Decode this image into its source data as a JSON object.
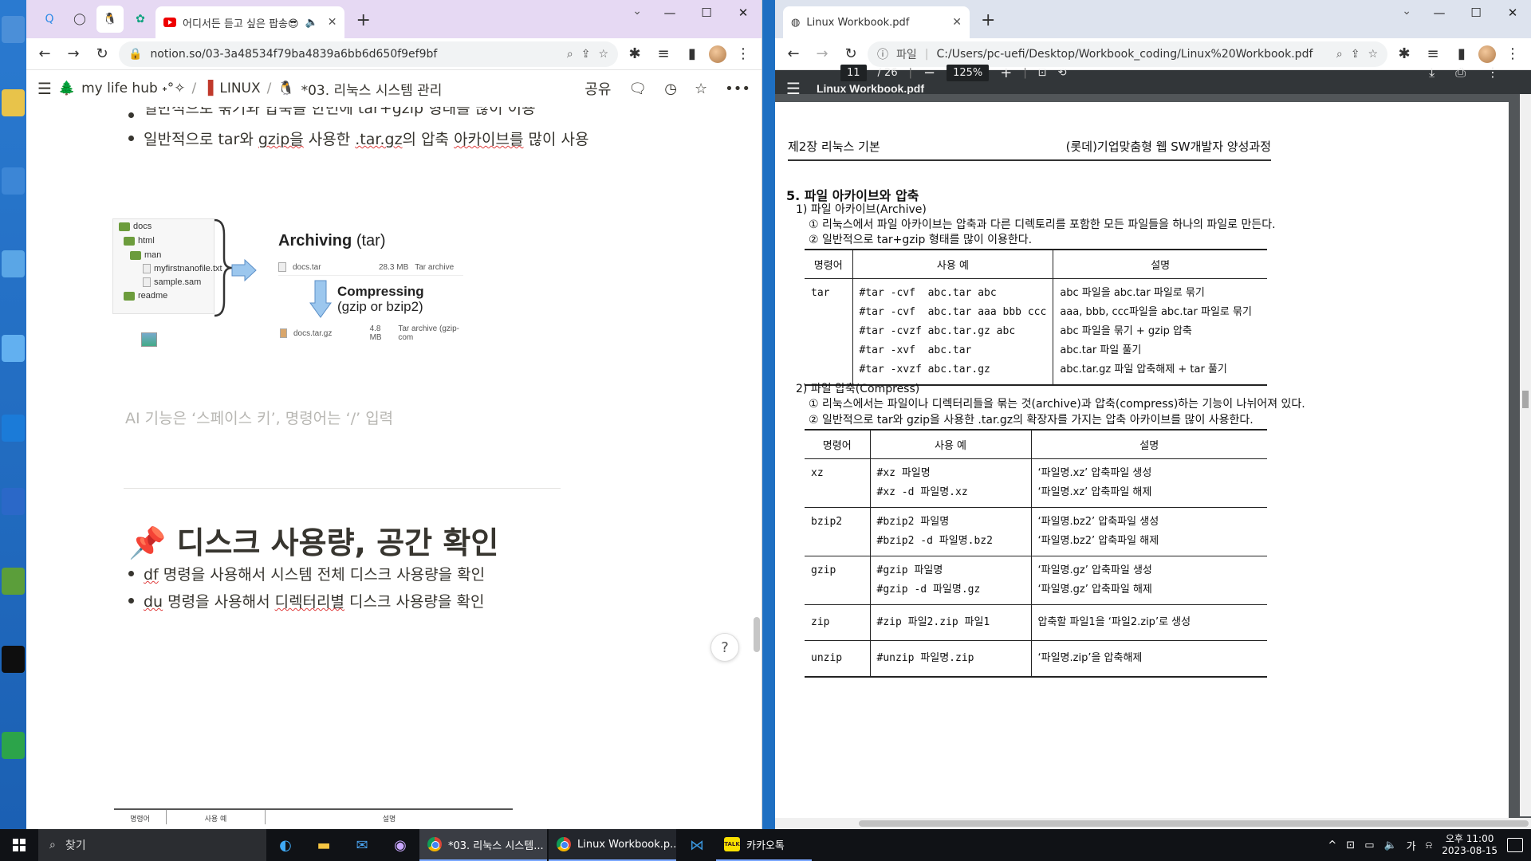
{
  "left_window": {
    "tabs": [
      {
        "icon": "qq-icon"
      },
      {
        "icon": "github-icon"
      },
      {
        "icon": "notion-penguin-icon",
        "active": true
      },
      {
        "icon": "chatgpt-icon"
      }
    ],
    "youtube_tab_title": "어디서든 듣고 싶은 팝송😎",
    "url": "notion.so/03-3a48534f79ba4839a6bb6d650f9ef9bf",
    "breadcrumb": {
      "workspace": "my life hub ˖°✧",
      "parent": "LINUX",
      "page": "*03. 리눅스 시스템 관리"
    },
    "share_label": "공유",
    "content": {
      "bullet_top_partial": "일반적으로 묶기와 압축을 한번에 tar+gzip 형태를 많이 이용",
      "bullet_2": {
        "pre": "일반적으로 tar와 ",
        "w1": "gzip을",
        "mid": " 사용한 ",
        "w2": ".tar.gz",
        "mid2": "의 압축 ",
        "w3": "아카이브를",
        "post": " 많이 사용"
      },
      "diagram": {
        "tree": [
          "docs",
          "html",
          "man",
          "myfirstnanofile.txt",
          "sample.sam",
          "readme"
        ],
        "archiving_label": "Archiving",
        "archiving_tool": "(tar)",
        "tar_file": "docs.tar",
        "tar_size": "28.3 MB",
        "tar_type": "Tar archive",
        "compressing_label": "Compressing",
        "compressing_tools": "(gzip or bzip2)",
        "gz_file": "docs.tar.gz",
        "gz_size": "4.8 MB",
        "gz_type": "Tar archive (gzip-com"
      },
      "ai_placeholder": "AI 기능은 ‘스페이스 키’, 명령어는 ‘/’ 입력",
      "heading_emoji": "📌",
      "heading": "디스크 사용량, 공간 확인",
      "bullet_df": {
        "cmd": "df",
        "text": " 명령을 사용해서 시스템 전체 디스크 사용량을 확인"
      },
      "bullet_du": {
        "cmd": "du",
        "text_a": " 명령을 사용해서 ",
        "word": "디렉터리별",
        "text_b": " 디스크 사용량을 확인"
      },
      "mini_table_headers": [
        "명령어",
        "사용 예",
        "설명"
      ],
      "help_label": "?"
    }
  },
  "right_window": {
    "tab_title": "Linux Workbook.pdf",
    "url_prefix": "파일",
    "url": "C:/Users/pc-uefi/Desktop/Workbook_coding/Linux%20Workbook.pdf",
    "pdf_title": "Linux Workbook.pdf",
    "page_current": "11",
    "page_total": "/ 26",
    "zoom": "125%",
    "page": {
      "header_left": "제2장 리눅스 기본",
      "header_right": "(롯데)기업맞춤형 웹 SW개발자 양성과정",
      "section": "5. 파일 아카이브와 압축",
      "sub1": "1) 파일 아카이브(Archive)",
      "sub1_items": [
        "① 리눅스에서 파일 아카이브는 압축과 다른 디렉토리를 포함한 모든 파일들을 하나의 파일로 만든다.",
        "② 일반적으로 tar+gzip 형태를 많이 이용한다."
      ],
      "table1": {
        "headers": [
          "명령어",
          "사용 예",
          "설명"
        ],
        "command": "tar",
        "examples": "#tar -cvf  abc.tar abc\n#tar -cvf  abc.tar aaa bbb ccc\n#tar -cvzf abc.tar.gz abc\n#tar -xvf  abc.tar\n#tar -xvzf abc.tar.gz",
        "descriptions": "abc 파일을 abc.tar 파일로 묶기\naaa, bbb, ccc파일을 abc.tar 파일로 묶기\nabc 파일을 묶기 + gzip 압축\nabc.tar 파일 풀기\nabc.tar.gz 파일 압축해제 + tar 풀기"
      },
      "sub2": "2) 파일 압축(Compress)",
      "sub2_items": [
        "① 리눅스에서는 파일이나 디렉터리들을 묶는 것(archive)과 압축(compress)하는 기능이 나뉘어져 있다.",
        "② 일반적으로 tar와 gzip을 사용한 .tar.gz의 확장자를 가지는 압축 아카이브를 많이 사용한다."
      ],
      "table2": {
        "headers": [
          "명령어",
          "사용 예",
          "설명"
        ],
        "rows": [
          {
            "cmd": "xz",
            "ex": "#xz 파일명\n#xz -d 파일명.xz",
            "desc": "‘파일명.xz’ 압축파일 생성\n‘파일명.xz’ 압축파일 해제"
          },
          {
            "cmd": "bzip2",
            "ex": "#bzip2 파일명\n#bzip2 -d 파일명.bz2",
            "desc": "‘파일명.bz2’ 압축파일 생성\n‘파일명.bz2’ 압축파일 해제"
          },
          {
            "cmd": "gzip",
            "ex": "#gzip 파일명\n#gzip -d 파일명.gz",
            "desc": "‘파일명.gz’ 압축파일 생성\n‘파일명.gz’ 압축파일 해제"
          },
          {
            "cmd": "zip",
            "ex": "#zip 파일2.zip 파일1",
            "desc": "압축할 파일1을 ‘파일2.zip’로 생성"
          },
          {
            "cmd": "unzip",
            "ex": "#unzip 파일명.zip",
            "desc": "‘파일명.zip’을 압축해제"
          }
        ]
      }
    }
  },
  "taskbar": {
    "search_label": "찾기",
    "apps": [
      {
        "label": "*03. 리눅스 시스템...",
        "active": true
      },
      {
        "label": "Linux Workbook.p..."
      }
    ],
    "kakao_label": "카카오톡",
    "kakao_icon_text": "TALK",
    "ime_label": "가",
    "time": "오후 11:00",
    "date": "2023-08-15"
  },
  "colors": {
    "notion_text": "#37352f",
    "pdf_toolbar": "#323639",
    "pdf_bg": "#525659",
    "taskbar": "#101216"
  }
}
